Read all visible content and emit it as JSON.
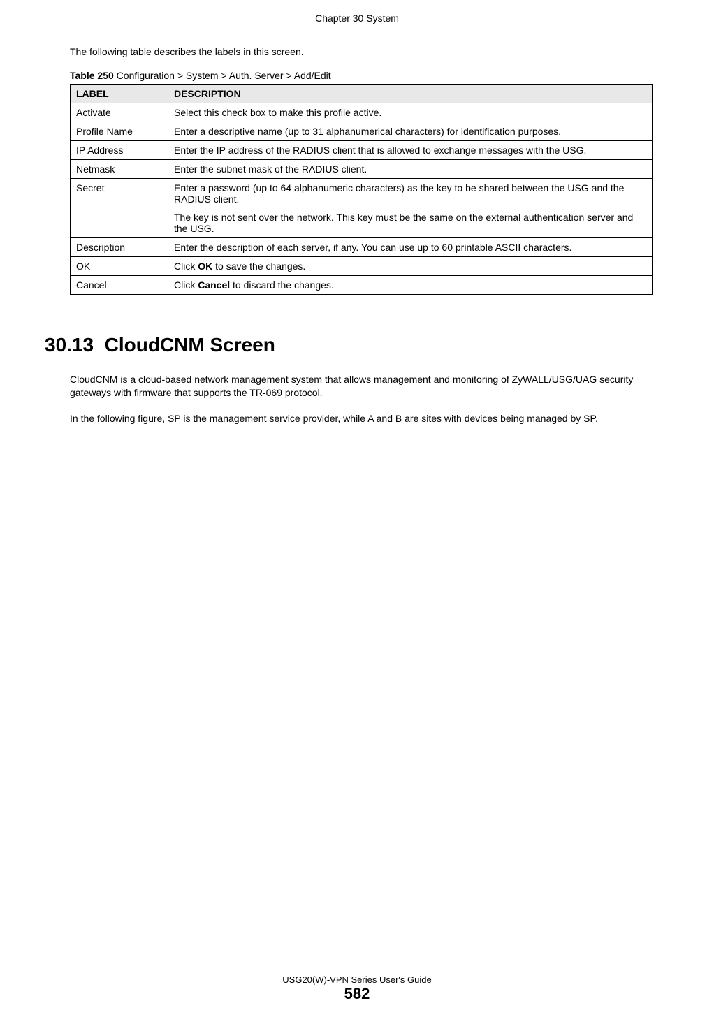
{
  "header": {
    "chapter": "Chapter 30 System"
  },
  "intro": "The following table describes the labels in this screen.",
  "table": {
    "caption_prefix": "Table 250",
    "caption_rest": "   Configuration > System > Auth. Server > Add/Edit",
    "header_label": "LABEL",
    "header_desc": "DESCRIPTION",
    "rows": [
      {
        "label": "Activate",
        "desc": "Select this check box to make this profile active."
      },
      {
        "label": "Profile Name",
        "desc": "Enter a descriptive name (up to 31 alphanumerical characters) for identification purposes."
      },
      {
        "label": "IP Address",
        "desc": "Enter the IP address of the RADIUS client that is allowed to exchange messages with the USG."
      },
      {
        "label": "Netmask",
        "desc": "Enter the subnet mask of the RADIUS client."
      },
      {
        "label": "Secret",
        "desc_p1": "Enter a password (up to 64 alphanumeric characters) as the key to be shared between the USG and the RADIUS client.",
        "desc_p2": "The key is not sent over the network. This key must be the same on the external authentication server and the USG."
      },
      {
        "label": "Description",
        "desc": "Enter the description of each server, if any. You can use up to 60 printable ASCII characters."
      },
      {
        "label": "OK",
        "desc_pre": "Click ",
        "desc_bold": "OK",
        "desc_post": " to save the changes."
      },
      {
        "label": "Cancel",
        "desc_pre": "Click ",
        "desc_bold": "Cancel",
        "desc_post": " to discard the changes."
      }
    ]
  },
  "section": {
    "number": "30.13",
    "title": "CloudCNM Screen",
    "para1": "CloudCNM is a cloud-based network management system that allows management and monitoring of ZyWALL/USG/UAG security gateways with firmware that supports the TR-069 protocol.",
    "para2": "In the following figure, SP is the management service provider, while A and B are sites with devices being managed by SP."
  },
  "footer": {
    "guide": "USG20(W)-VPN Series User's Guide",
    "page": "582"
  }
}
